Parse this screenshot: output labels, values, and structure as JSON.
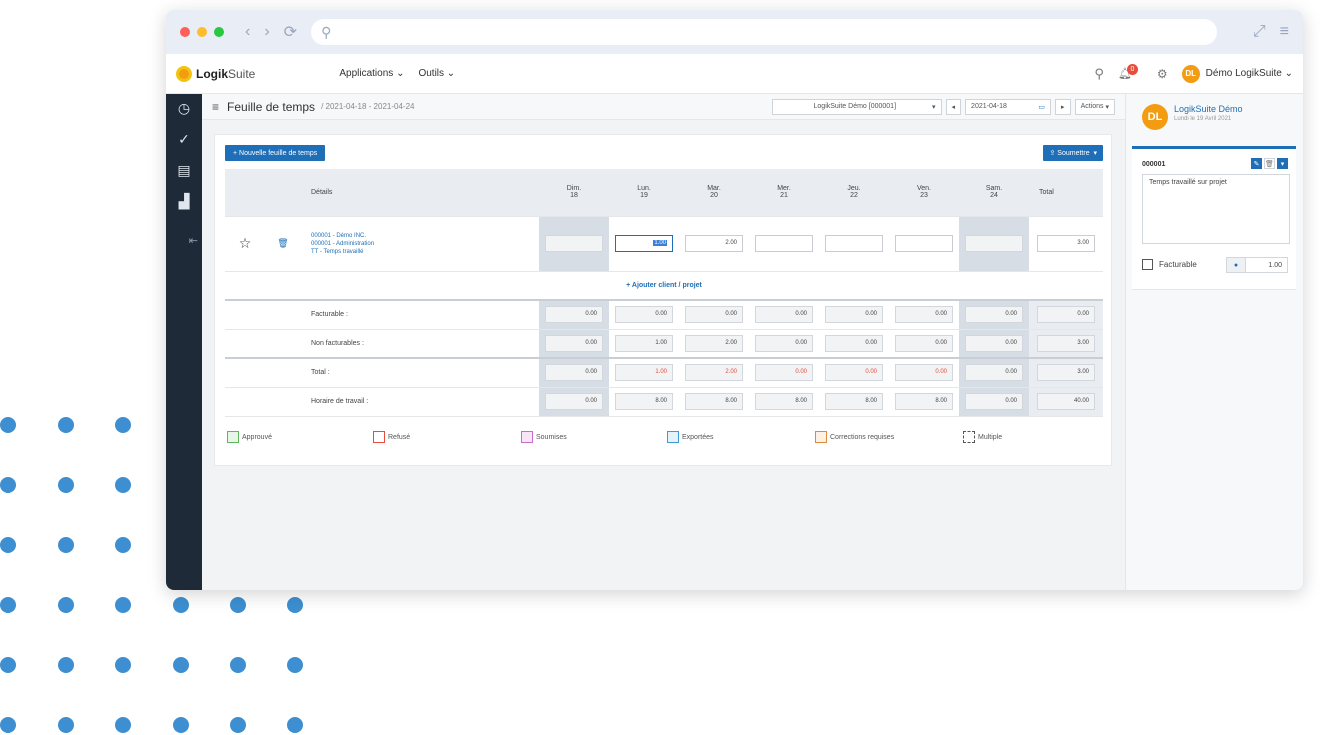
{
  "browser": {
    "search_icon": "search-icon"
  },
  "app": {
    "logo_bold": "Logik",
    "logo_light": "Suite",
    "menu": [
      "Applications",
      "Outils"
    ],
    "notification_count": "0",
    "user_initials": "DL",
    "user_name": "Démo LogikSuite"
  },
  "page": {
    "title": "Feuille de temps",
    "range": "/ 2021-04-18 - 2021-04-24",
    "client_select": "LogikSuite Démo [000001]",
    "date_value": "2021-04-18",
    "actions_label": "Actions"
  },
  "sheet": {
    "new_button": "+ Nouvelle feuille de temps",
    "submit_button": "Soumettre",
    "details_header": "Détails",
    "total_header": "Total",
    "days": [
      {
        "name": "Dim.",
        "num": "18"
      },
      {
        "name": "Lun.",
        "num": "19"
      },
      {
        "name": "Mar.",
        "num": "20"
      },
      {
        "name": "Mer.",
        "num": "21"
      },
      {
        "name": "Jeu.",
        "num": "22"
      },
      {
        "name": "Ven.",
        "num": "23"
      },
      {
        "name": "Sam.",
        "num": "24"
      }
    ],
    "entry": {
      "lines": [
        "000001 - Démo INC.",
        "000001 - Administration",
        "TT - Temps travaillé"
      ],
      "values": [
        "",
        "1.00",
        "2.00",
        "",
        "",
        "",
        ""
      ],
      "total": "3.00"
    },
    "add_link": "+ Ajouter client / projet",
    "summary_rows": [
      {
        "label": "Facturable :",
        "values": [
          "0.00",
          "0.00",
          "0.00",
          "0.00",
          "0.00",
          "0.00",
          "0.00"
        ],
        "total": "0.00"
      },
      {
        "label": "Non facturables :",
        "values": [
          "0.00",
          "1.00",
          "2.00",
          "0.00",
          "0.00",
          "0.00",
          "0.00"
        ],
        "total": "3.00"
      },
      {
        "label": "Total :",
        "values": [
          "0.00",
          "1.00",
          "2.00",
          "0.00",
          "0.00",
          "0.00",
          "0.00"
        ],
        "total": "3.00"
      },
      {
        "label": "Horaire de travail :",
        "values": [
          "0.00",
          "8.00",
          "8.00",
          "8.00",
          "8.00",
          "8.00",
          "0.00"
        ],
        "total": "40.00"
      }
    ],
    "legend": [
      {
        "label": "Approuvé",
        "color": "#5cb85c"
      },
      {
        "label": "Refusé",
        "color": "#e74c3c"
      },
      {
        "label": "Soumises",
        "color": "#c86ec8"
      },
      {
        "label": "Exportées",
        "color": "#3a9bd5"
      },
      {
        "label": "Corrections requises",
        "color": "#e0893a"
      },
      {
        "label": "Multiple",
        "color": "#555555"
      }
    ]
  },
  "panel": {
    "initials": "DL",
    "name": "LogikSuite Démo",
    "date": "Lundi le 19 Avril 2021",
    "code": "000001",
    "note": "Temps travaillé sur projet",
    "billable_label": "Facturable",
    "hours": "1.00"
  }
}
